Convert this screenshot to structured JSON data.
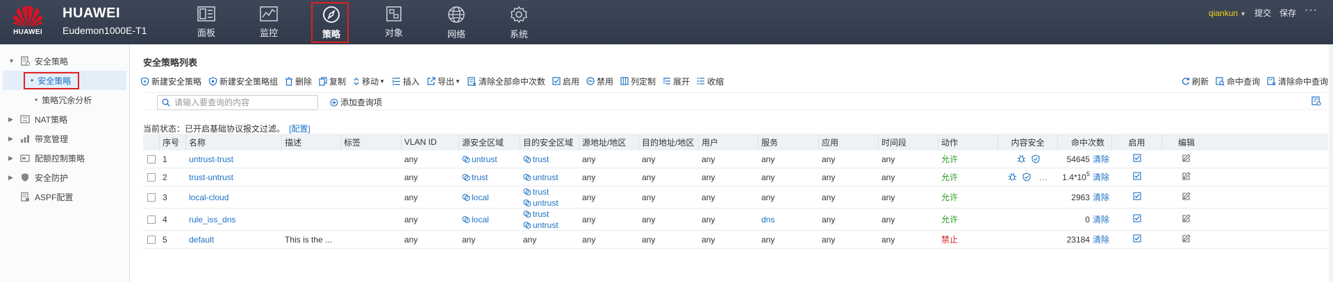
{
  "header": {
    "logo_text": "HUAWEI",
    "brand": "HUAWEI",
    "model": "Eudemon1000E-T1",
    "nav": [
      {
        "label": "面板",
        "icon": "dashboard-icon"
      },
      {
        "label": "监控",
        "icon": "monitor-icon"
      },
      {
        "label": "策略",
        "icon": "compass-icon",
        "active": true
      },
      {
        "label": "对象",
        "icon": "object-icon"
      },
      {
        "label": "网络",
        "icon": "globe-icon"
      },
      {
        "label": "系统",
        "icon": "gear-icon"
      }
    ],
    "user": "qiankun",
    "submit": "提交",
    "save": "保存",
    "more": "···"
  },
  "sidebar": {
    "items": [
      {
        "label": "安全策略",
        "icon": "security-policy-icon",
        "expanded": true
      },
      {
        "label": "安全策略",
        "child": true,
        "active": true
      },
      {
        "label": "策略冗余分析",
        "child": true
      },
      {
        "label": "NAT策略",
        "icon": "nat-icon"
      },
      {
        "label": "带宽管理",
        "icon": "bandwidth-icon"
      },
      {
        "label": "配额控制策略",
        "icon": "quota-icon"
      },
      {
        "label": "安全防护",
        "icon": "shield-icon"
      },
      {
        "label": "ASPF配置",
        "icon": "aspf-icon"
      }
    ]
  },
  "page": {
    "title": "安全策略列表",
    "toolbar": {
      "new_policy": "新建安全策略",
      "new_group": "新建安全策略组",
      "delete": "删除",
      "copy": "复制",
      "move": "移动",
      "insert": "插入",
      "export": "导出",
      "clear_all_hits": "清除全部命中次数",
      "enable": "启用",
      "disable": "禁用",
      "custom_columns": "列定制",
      "expand": "展开",
      "collapse": "收缩",
      "refresh": "刷新",
      "hit_query": "命中查询",
      "clear_hit_query": "清除命中查询"
    },
    "search": {
      "placeholder": "请输入要查询的内容"
    },
    "add_query": "添加查询项",
    "status": {
      "label": "当前状态：已开启基础协议报文过滤。",
      "config_link": "[配置]"
    }
  },
  "table": {
    "headers": [
      "序号",
      "名称",
      "描述",
      "标签",
      "VLAN ID",
      "源安全区域",
      "目的安全区域",
      "源地址/地区",
      "目的地址/地区",
      "用户",
      "服务",
      "应用",
      "时间段",
      "动作",
      "内容安全",
      "命中次数",
      "启用",
      "编辑"
    ],
    "rows": [
      {
        "no": "1",
        "name": "untrust-trust",
        "desc": "",
        "tag": "",
        "vlan": "any",
        "src_zone": [
          "untrust"
        ],
        "dst_zone": [
          "trust"
        ],
        "src_addr": "any",
        "dst_addr": "any",
        "user": "any",
        "service": "any",
        "app": "any",
        "time": "any",
        "action": "允许",
        "content_sec": "icons",
        "hits": "54645",
        "enabled": true
      },
      {
        "no": "2",
        "name": "trust-untrust",
        "desc": "",
        "tag": "",
        "vlan": "any",
        "src_zone": [
          "trust"
        ],
        "dst_zone": [
          "untrust"
        ],
        "src_addr": "any",
        "dst_addr": "any",
        "user": "any",
        "service": "any",
        "app": "any",
        "time": "any",
        "action": "允许",
        "content_sec": "icons-more",
        "hits": "1.4*10",
        "hits_exp": "5",
        "enabled": true
      },
      {
        "no": "3",
        "name": "local-cloud",
        "desc": "",
        "tag": "",
        "vlan": "any",
        "src_zone": [
          "local"
        ],
        "dst_zone": [
          "trust",
          "untrust"
        ],
        "src_addr": "any",
        "dst_addr": "any",
        "user": "any",
        "service": "any",
        "app": "any",
        "time": "any",
        "action": "允许",
        "content_sec": "",
        "hits": "2963",
        "enabled": true
      },
      {
        "no": "4",
        "name": "rule_iss_dns",
        "desc": "",
        "tag": "",
        "vlan": "any",
        "src_zone": [
          "local"
        ],
        "dst_zone": [
          "trust",
          "untrust"
        ],
        "src_addr": "any",
        "dst_addr": "any",
        "user": "any",
        "service": "dns",
        "app": "any",
        "time": "any",
        "action": "允许",
        "content_sec": "",
        "hits": "0",
        "enabled": true
      },
      {
        "no": "5",
        "name": "default",
        "desc": "This is the ...",
        "tag": "",
        "vlan": "any",
        "src_zone_text": "any",
        "dst_zone_text": "any",
        "src_addr": "any",
        "dst_addr": "any",
        "user": "any",
        "service": "any",
        "app": "any",
        "time": "any",
        "action": "禁止",
        "content_sec": "",
        "hits": "23184",
        "enabled": true
      }
    ],
    "clear_label": "清除"
  },
  "colors": {
    "topbar": "#353e4f",
    "link": "#1c71c7",
    "allow": "#2a9d1f",
    "deny": "#d42323",
    "highlight": "#e02020",
    "user": "#f6d21a"
  }
}
